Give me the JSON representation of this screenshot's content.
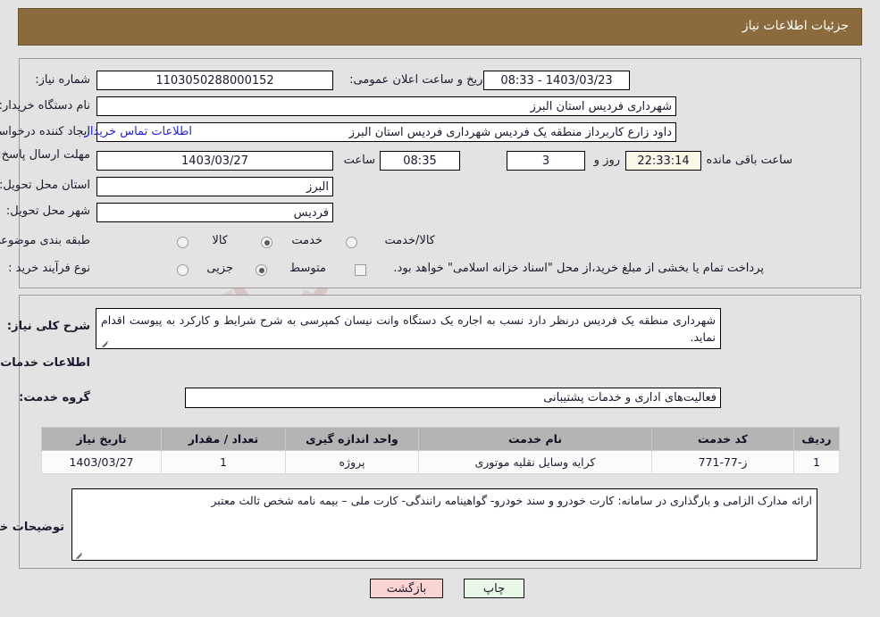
{
  "header": {
    "title": "جزئیات اطلاعات نیاز"
  },
  "top_panel": {
    "need_number_label": "شماره نیاز:",
    "need_number_value": "1103050288000152",
    "announce_label": "تاریخ و ساعت اعلان عمومی:",
    "announce_value": "1403/03/23 - 08:33",
    "buyer_org_label": "نام دستگاه خریدار:",
    "buyer_org_value": "شهرداری فردیس استان البرز",
    "requester_label": "ایجاد کننده درخواست:",
    "requester_value": "داود زارع کاربرداز منطقه یک فردیس شهرداری فردیس استان البرز",
    "contact_link": "اطلاعات تماس خریدار",
    "deadline_label": "مهلت ارسال پاسخ: تا تاریخ:",
    "deadline_date": "1403/03/27",
    "deadline_time_label": "ساعت",
    "deadline_time": "08:35",
    "remaining_days": "3",
    "days_and_label": "روز و",
    "remaining_time": "22:33:14",
    "remaining_suffix": "ساعت باقی مانده",
    "province_label": "استان محل تحویل:",
    "province_value": "البرز",
    "city_label": "شهر محل تحویل:",
    "city_value": "فردیس",
    "category_label": "طبقه بندی موضوعی:",
    "category_options": [
      "کالا",
      "خدمت",
      "کالا/خدمت"
    ],
    "category_selected": "خدمت",
    "process_label": "نوع فرآیند خرید :",
    "process_options": [
      "جزیی",
      "متوسط"
    ],
    "process_selected": "متوسط",
    "treasury_checkbox_label": "پرداخت تمام یا بخشی از مبلغ خرید،از محل \"اسناد خزانه اسلامی\" خواهد بود.",
    "treasury_checked": false
  },
  "bottom_panel": {
    "general_desc_label": "شرح کلی نیاز:",
    "general_desc_value": "شهرداری منطقه یک فردیس درنظر دارد نسب  به اجاره یک دستگاه وانت نیسان کمپرسی به شرح شرایط و کارکرد به پیوست اقدام نماید.",
    "services_section_title": "اطلاعات خدمات مورد نیاز",
    "service_group_label": "گروه خدمت:",
    "service_group_value": "فعالیت‌های اداری و خدمات پشتیبانی",
    "table": {
      "headers": [
        "ردیف",
        "کد خدمت",
        "نام خدمت",
        "واحد اندازه گیری",
        "تعداد / مقدار",
        "تاریخ نیاز"
      ],
      "rows": [
        {
          "row_no": "1",
          "service_code": "ز-77-771",
          "service_name": "کرایه وسایل نقلیه موتوری",
          "unit": "پروژه",
          "quantity": "1",
          "need_date": "1403/03/27"
        }
      ]
    },
    "buyer_notes_label": "توضیحات خریدار:",
    "buyer_notes_value": "ارائه مدارک الزامی و بارگذاری در سامانه: کارت خودرو و سند خودرو- گواهینامه رانندگی- کارت ملی – بیمه نامه شخص ثالث معتبر"
  },
  "footer": {
    "print_label": "چاپ",
    "back_label": "بازگشت"
  },
  "watermark": {
    "text": "AriaTender",
    "text_suffix": ".net"
  },
  "colors": {
    "header_bg": "#8b6b3e",
    "page_bg": "#e3e3e3",
    "link": "#2222dd",
    "print_btn": "#e9f7e9",
    "back_btn": "#fbd3d3",
    "countdown_bg": "#faf7e6",
    "table_header_bg": "#b4b4b4"
  }
}
